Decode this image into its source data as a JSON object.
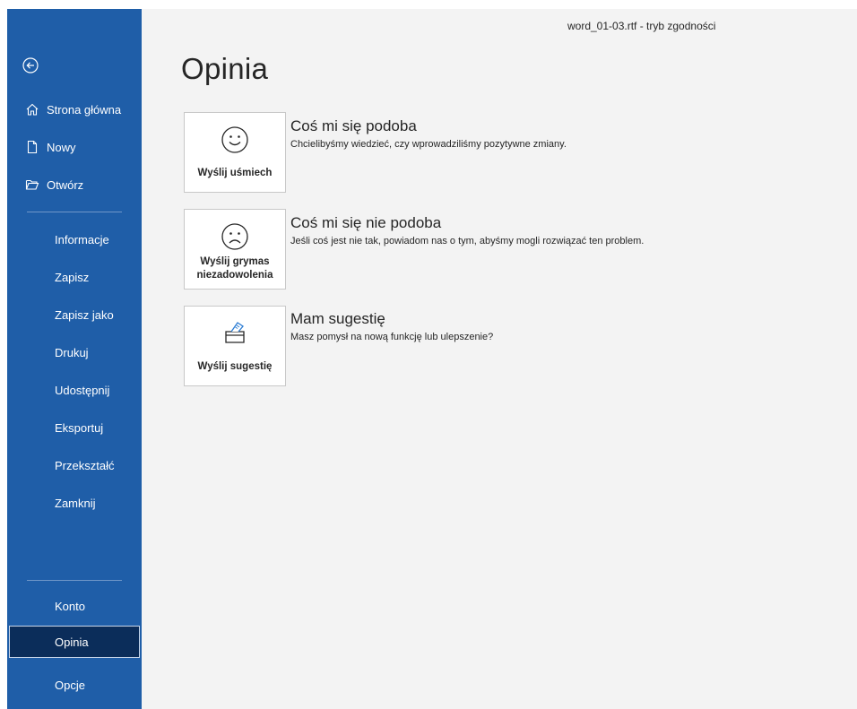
{
  "window": {
    "title": "word_01-03.rtf  -  tryb zgodności"
  },
  "sidebar": {
    "top_items": [
      {
        "label": "Strona główna",
        "icon": "home-icon"
      },
      {
        "label": "Nowy",
        "icon": "new-document-icon"
      },
      {
        "label": "Otwórz",
        "icon": "open-folder-icon"
      }
    ],
    "items": [
      {
        "label": "Informacje"
      },
      {
        "label": "Zapisz"
      },
      {
        "label": "Zapisz jako"
      },
      {
        "label": "Drukuj"
      },
      {
        "label": "Udostępnij"
      },
      {
        "label": "Eksportuj"
      },
      {
        "label": "Przekształć"
      },
      {
        "label": "Zamknij"
      }
    ],
    "bottom_items": [
      {
        "label": "Konto"
      },
      {
        "label": "Opinia",
        "selected": true
      },
      {
        "label": "Opcje"
      }
    ]
  },
  "main": {
    "heading": "Opinia",
    "options": [
      {
        "button_label": "Wyślij uśmiech",
        "icon": "smile-icon",
        "title": "Coś mi się podoba",
        "description": "Chcielibyśmy wiedzieć, czy wprowadziliśmy pozytywne zmiany."
      },
      {
        "button_label_line1": "Wyślij grymas",
        "button_label_line2": "niezadowolenia",
        "icon": "frown-icon",
        "title": "Coś mi się nie podoba",
        "description": "Jeśli coś jest nie tak, powiadom nas o tym, abyśmy mogli rozwiązać ten problem."
      },
      {
        "button_label": "Wyślij sugestię",
        "icon": "suggestion-box-icon",
        "title": "Mam sugestię",
        "description": "Masz pomysł na nową funkcję lub ulepszenie?"
      }
    ]
  },
  "colors": {
    "sidebar_bg": "#1f5ea8",
    "selected_bg": "#0b2d5a",
    "main_bg": "#f3f3f3",
    "accent": "#2b7cd3"
  }
}
